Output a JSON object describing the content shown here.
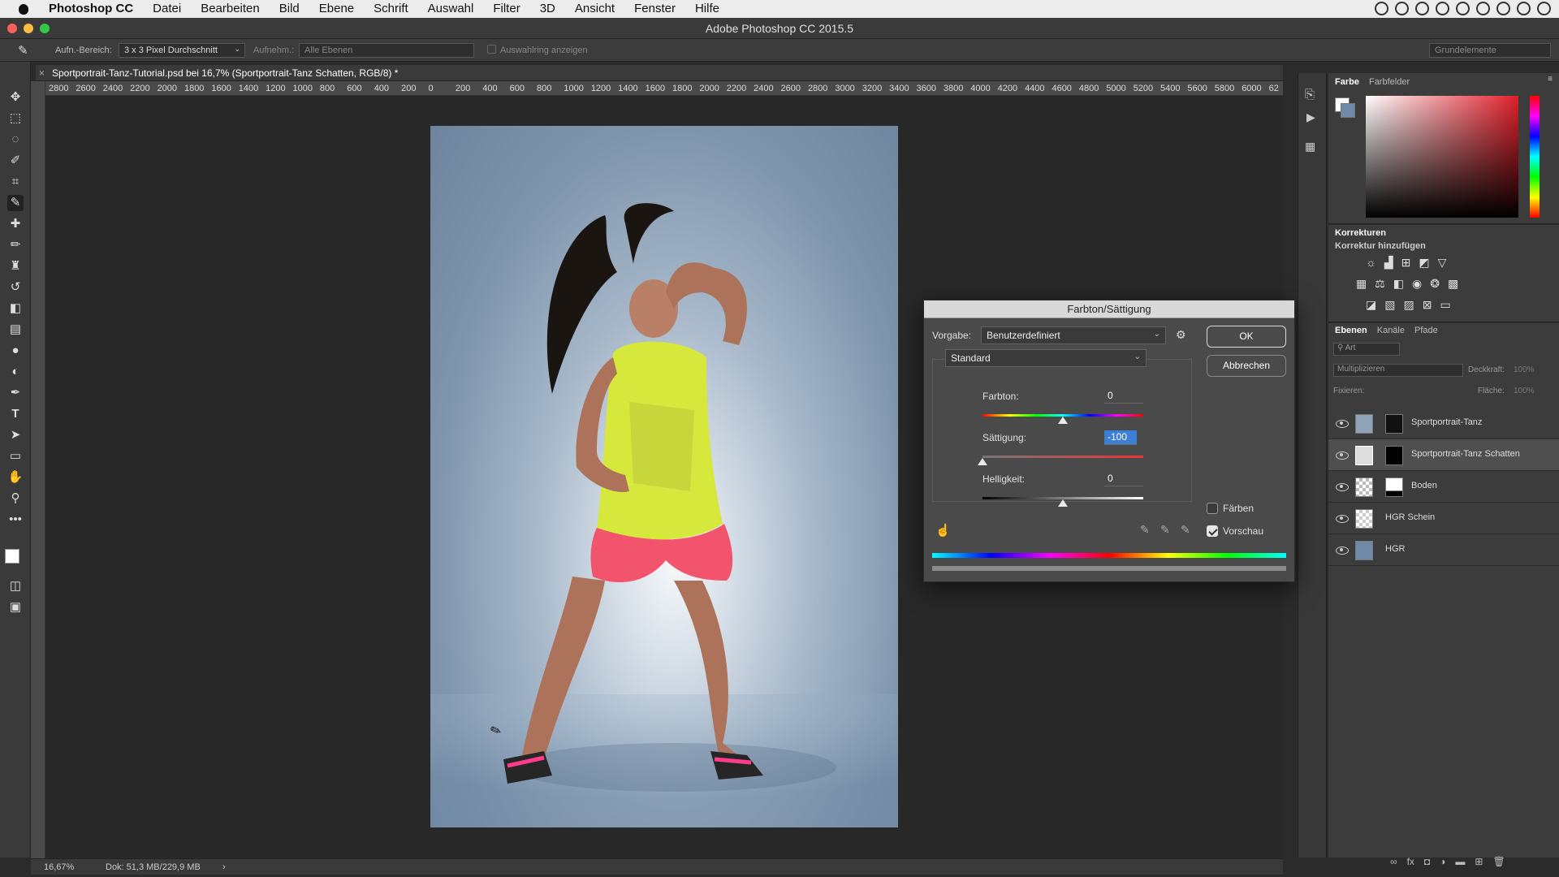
{
  "menubar": {
    "app_name": "Photoshop CC",
    "items": [
      "Datei",
      "Bearbeiten",
      "Bild",
      "Ebene",
      "Schrift",
      "Auswahl",
      "Filter",
      "3D",
      "Ansicht",
      "Fenster",
      "Hilfe"
    ]
  },
  "window": {
    "title": "Adobe Photoshop CC 2015.5"
  },
  "options": {
    "sample_size_label": "Aufn.-Bereich:",
    "sample_size_value": "3 x 3 Pixel Durchschnitt",
    "sample_label": "Aufnehm.:",
    "sample_value": "Alle Ebenen",
    "show_ring": "Auswahlring anzeigen",
    "workspace": "Grundelemente"
  },
  "document": {
    "tab_title": "Sportportrait-Tanz-Tutorial.psd bei 16,7% (Sportportrait-Tanz Schatten, RGB/8) *",
    "ruler_h": [
      "2800",
      "2600",
      "2400",
      "2200",
      "2000",
      "1800",
      "1600",
      "1400",
      "1200",
      "1000",
      "800",
      "600",
      "400",
      "200",
      "0",
      "200",
      "400",
      "600",
      "800",
      "1000",
      "1200",
      "1400",
      "1600",
      "1800",
      "2000",
      "2200",
      "2400",
      "2600",
      "2800",
      "3000",
      "3200",
      "3400",
      "3600",
      "3800",
      "4000",
      "4200",
      "4400",
      "4600",
      "4800",
      "5000",
      "5200",
      "5400",
      "5600",
      "5800",
      "6000",
      "62"
    ]
  },
  "status": {
    "zoom": "16,67%",
    "doc": "Dok: 51,3 MB/229,9 MB"
  },
  "panels": {
    "color_tabs": [
      "Farbe",
      "Farbfelder"
    ],
    "corrections_title": "Korrekturen",
    "corrections_add": "Korrektur hinzufügen",
    "layers_tabs": [
      "Ebenen",
      "Kanäle",
      "Pfade"
    ],
    "filter_placeholder": "Art",
    "blend_mode": "Multiplizieren",
    "opacity_label": "Deckkraft:",
    "opacity_value": "100%",
    "lock_label": "Fixieren:",
    "fill_label": "Fläche:",
    "fill_value": "100%"
  },
  "layers": [
    {
      "name": "Sportportrait-Tanz",
      "selected": false
    },
    {
      "name": "Sportportrait-Tanz Schatten",
      "selected": true
    },
    {
      "name": "Boden",
      "selected": false
    },
    {
      "name": "HGR Schein",
      "selected": false
    },
    {
      "name": "HGR",
      "selected": false
    }
  ],
  "dialog": {
    "title": "Farbton/Sättigung",
    "preset_label": "Vorgabe:",
    "preset_value": "Benutzerdefiniert",
    "channel_value": "Standard",
    "ok": "OK",
    "cancel": "Abbrechen",
    "hue_label": "Farbton:",
    "hue_value": "0",
    "saturation_label": "Sättigung:",
    "saturation_value": "-100",
    "lightness_label": "Helligkeit:",
    "lightness_value": "0",
    "colorize_label": "Färben",
    "colorize_checked": false,
    "preview_label": "Vorschau",
    "preview_checked": true
  }
}
